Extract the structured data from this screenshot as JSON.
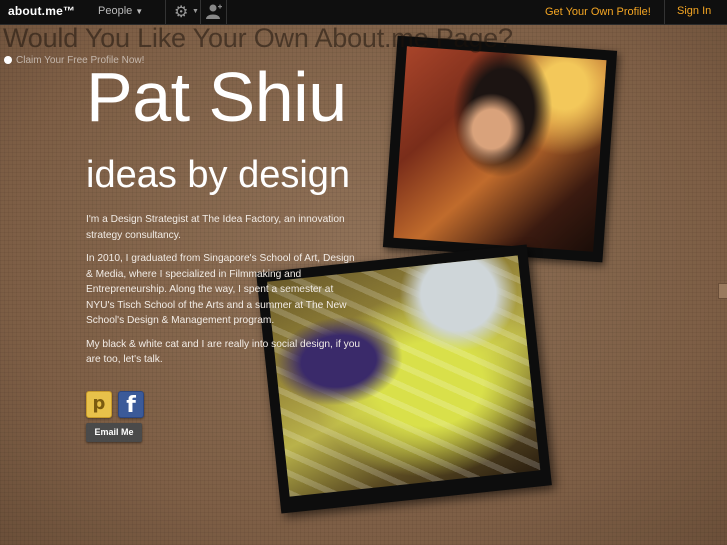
{
  "topbar": {
    "logo": "about.me™",
    "people_label": "People",
    "gear_icon": "gear-icon",
    "person_icon": "add-person-icon",
    "get_own_label": "Get Your Own Profile!",
    "sign_in_label": "Sign In"
  },
  "promo": {
    "title": "Would You Like Your Own About.me Page?",
    "claim_label": "Claim Your Free Profile Now!"
  },
  "profile": {
    "name": "Pat Shiu",
    "headline": "ideas by design",
    "bio": [
      "I'm a Design Strategist at The Idea Factory, an innovation strategy consultancy.",
      "In 2010, I graduated from Singapore's School of Art, Design & Media, where I specialized in Filmmaking and Entrepreneurship. Along the way, I spent a semester at NYU's Tisch School of the Arts and a summer at The New School's Design & Management program.",
      "My black & white cat and I are really into social design, if you are too, let's talk."
    ]
  },
  "social": {
    "path_letter": "p",
    "facebook_letter": "f",
    "email_label": "Email Me"
  },
  "colors": {
    "topbar_bg": "#0f0f0f",
    "accent": "#f5a623",
    "background": "#8a6a50"
  }
}
